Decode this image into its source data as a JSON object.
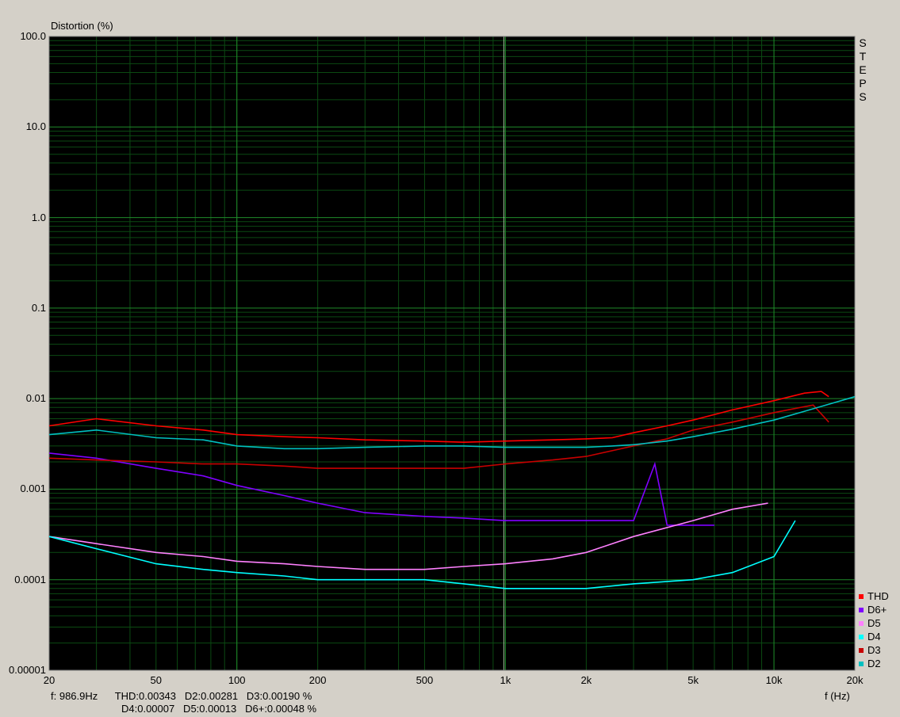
{
  "chart_data": {
    "type": "line",
    "ylabel": "Distortion (%)",
    "xlabel": "f (Hz)",
    "y_scale": "log",
    "x_scale": "log",
    "ylim": [
      1e-05,
      100
    ],
    "xlim": [
      20,
      20000
    ],
    "y_ticks": [
      "100.0",
      "10.0",
      "1.0",
      "0.1",
      "0.01",
      "0.001",
      "0.0001",
      "0.00001"
    ],
    "x_ticks": [
      "20",
      "50",
      "100",
      "200",
      "500",
      "1k",
      "2k",
      "5k",
      "10k",
      "20k"
    ],
    "grid": true,
    "legend_position": "bottom-right",
    "steps_label": "STEPS",
    "cursor_frequency": 986.9,
    "readout_line1": "f: 986.9Hz      THD:0.00343   D2:0.00281   D3:0.00190 %",
    "readout_line2": "D4:0.00007   D5:0.00013   D6+:0.00048 %",
    "series": [
      {
        "name": "THD",
        "color": "#ff0000",
        "x": [
          20,
          30,
          50,
          75,
          100,
          150,
          200,
          300,
          500,
          700,
          1000,
          1500,
          2000,
          2500,
          3000,
          4000,
          5000,
          7000,
          10000,
          13000,
          15000,
          16000
        ],
        "values": [
          0.005,
          0.006,
          0.005,
          0.0045,
          0.004,
          0.0038,
          0.0037,
          0.0035,
          0.0034,
          0.0033,
          0.0034,
          0.0035,
          0.0036,
          0.0037,
          0.0042,
          0.005,
          0.0058,
          0.0075,
          0.0095,
          0.0115,
          0.012,
          0.0105
        ]
      },
      {
        "name": "D6+",
        "color": "#7f00ff",
        "x": [
          20,
          30,
          50,
          75,
          100,
          150,
          200,
          300,
          500,
          700,
          1000,
          1500,
          2000,
          3000,
          3600,
          4000,
          5000,
          6000
        ],
        "values": [
          0.0025,
          0.0022,
          0.0017,
          0.0014,
          0.0011,
          0.00085,
          0.0007,
          0.00055,
          0.0005,
          0.00048,
          0.00045,
          0.00045,
          0.00045,
          0.00045,
          0.0019,
          0.0004,
          0.0004,
          0.0004
        ]
      },
      {
        "name": "D5",
        "color": "#ff80ff",
        "x": [
          20,
          30,
          50,
          75,
          100,
          150,
          200,
          300,
          500,
          700,
          1000,
          1500,
          2000,
          3000,
          5000,
          7000,
          9500
        ],
        "values": [
          0.0003,
          0.00025,
          0.0002,
          0.00018,
          0.00016,
          0.00015,
          0.00014,
          0.00013,
          0.00013,
          0.00014,
          0.00015,
          0.00017,
          0.0002,
          0.0003,
          0.00045,
          0.0006,
          0.0007
        ]
      },
      {
        "name": "D4",
        "color": "#00ffff",
        "x": [
          20,
          30,
          50,
          75,
          100,
          150,
          200,
          300,
          500,
          700,
          1000,
          1500,
          2000,
          3000,
          5000,
          7000,
          10000,
          12000
        ],
        "values": [
          0.0003,
          0.00022,
          0.00015,
          0.00013,
          0.00012,
          0.00011,
          0.0001,
          0.0001,
          0.0001,
          9e-05,
          8e-05,
          8e-05,
          8e-05,
          9e-05,
          0.0001,
          0.00012,
          0.00018,
          0.00045
        ]
      },
      {
        "name": "D3",
        "color": "#c80000",
        "x": [
          20,
          30,
          50,
          75,
          100,
          150,
          200,
          300,
          500,
          700,
          1000,
          1500,
          2000,
          3000,
          4000,
          5000,
          7000,
          10000,
          14000,
          16000
        ],
        "values": [
          0.0022,
          0.0021,
          0.002,
          0.0019,
          0.0019,
          0.0018,
          0.0017,
          0.0017,
          0.0017,
          0.0017,
          0.0019,
          0.0021,
          0.0023,
          0.003,
          0.0036,
          0.0045,
          0.0055,
          0.007,
          0.0085,
          0.0055
        ]
      },
      {
        "name": "D2",
        "color": "#00c0c0",
        "x": [
          20,
          30,
          50,
          75,
          100,
          150,
          200,
          300,
          500,
          700,
          1000,
          1500,
          2000,
          2500,
          3000,
          4000,
          5000,
          7000,
          10000,
          15000,
          20000
        ],
        "values": [
          0.004,
          0.0045,
          0.0037,
          0.0035,
          0.003,
          0.0028,
          0.0028,
          0.0029,
          0.003,
          0.003,
          0.0029,
          0.0029,
          0.0029,
          0.003,
          0.0031,
          0.0034,
          0.0038,
          0.0046,
          0.0058,
          0.0082,
          0.0105
        ]
      }
    ]
  }
}
